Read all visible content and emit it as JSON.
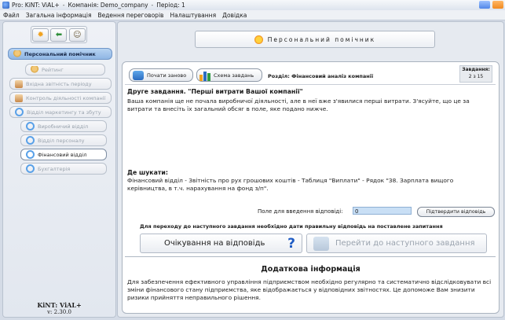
{
  "window": {
    "title_app": "Pro: KiNT: ViAL+",
    "title_company": "Компанія: Demo_company",
    "title_period": "Період: 1"
  },
  "menu": [
    "Файл",
    "Загальна інформація",
    "Ведення переговорів",
    "Налаштування",
    "Довідка"
  ],
  "toolbar": {
    "icons": [
      "sun-icon",
      "back-arrow-icon",
      "people-icon"
    ]
  },
  "sidebar": {
    "items": [
      {
        "label": "Персональний помічник",
        "state": "active",
        "icon": "person-icon"
      },
      {
        "label": "Рейтинг",
        "state": "disabled",
        "icon": "rating-icon"
      },
      {
        "label": "Вхідна звітність періоду",
        "state": "disabled",
        "icon": "document-icon"
      },
      {
        "label": "Контроль діяльності компанії",
        "state": "disabled",
        "icon": "document-icon"
      },
      {
        "label": "Відділ маркетингу та збуту",
        "state": "disabled",
        "icon": "magnifier-icon"
      },
      {
        "label": "Виробничий відділ",
        "state": "disabled",
        "icon": "magnifier-icon"
      },
      {
        "label": "Відділ персоналу",
        "state": "disabled",
        "icon": "magnifier-icon"
      },
      {
        "label": "Фінансовий відділ",
        "state": "selected",
        "icon": "magnifier-icon"
      },
      {
        "label": "Бухгалтерія",
        "state": "disabled",
        "icon": "magnifier-icon"
      }
    ],
    "version_name": "KiNT: ViAL+",
    "version_number": "v: 2.30.0"
  },
  "main": {
    "assistant_title": "Персональний помічник",
    "restart_label": "Почати заново",
    "scheme_label": "Схема завдань",
    "section_label": "Розділ: Фінансовий аналіз компанії",
    "task_label": "Завдання:",
    "task_value": "2 з 15",
    "task_heading": "Друге завдання. \"Перші витрати Вашої компанії\"",
    "task_text": "Ваша компанія ще не почала виробничої діяльності, але в неї вже з'явилися перші витрати. З'ясуйте, що це за витрати та внесіть їх загальний обсяг в поле, яке подано нижче.",
    "where_heading": "Де шукати:",
    "where_text": "Фінансовий відділ - Звітність про рух грошових коштів - Таблиця \"Виплати\" - Рядок \"38. Зарплата вищого керівництва, в т.ч. нарахування на фонд з/п\".",
    "answer_label": "Поле для введення відповіді:",
    "answer_value": "0",
    "confirm_label": "Підтвердити відповідь",
    "notice": "Для переходу до наступного завдання необхідно дати правильну відповідь на поставлене запитання",
    "waiting_label": "Очікування на відповідь",
    "next_label": "Перейти до наступного завдання",
    "extra_heading": "Додаткова інформація",
    "extra_text": "Для забезпечення ефективного управління підприємством необхідно регулярно та систематично відслідковувати всі зміни фінансового стану підприємства, яке відображається у відповідних звітностях. Це допоможе Вам знизити ризики прийняття неправильного рішення."
  },
  "colors": {
    "accent": "#2b6cc0",
    "active_nav": "#8fb6e4",
    "field_bg": "#c9dff5"
  }
}
